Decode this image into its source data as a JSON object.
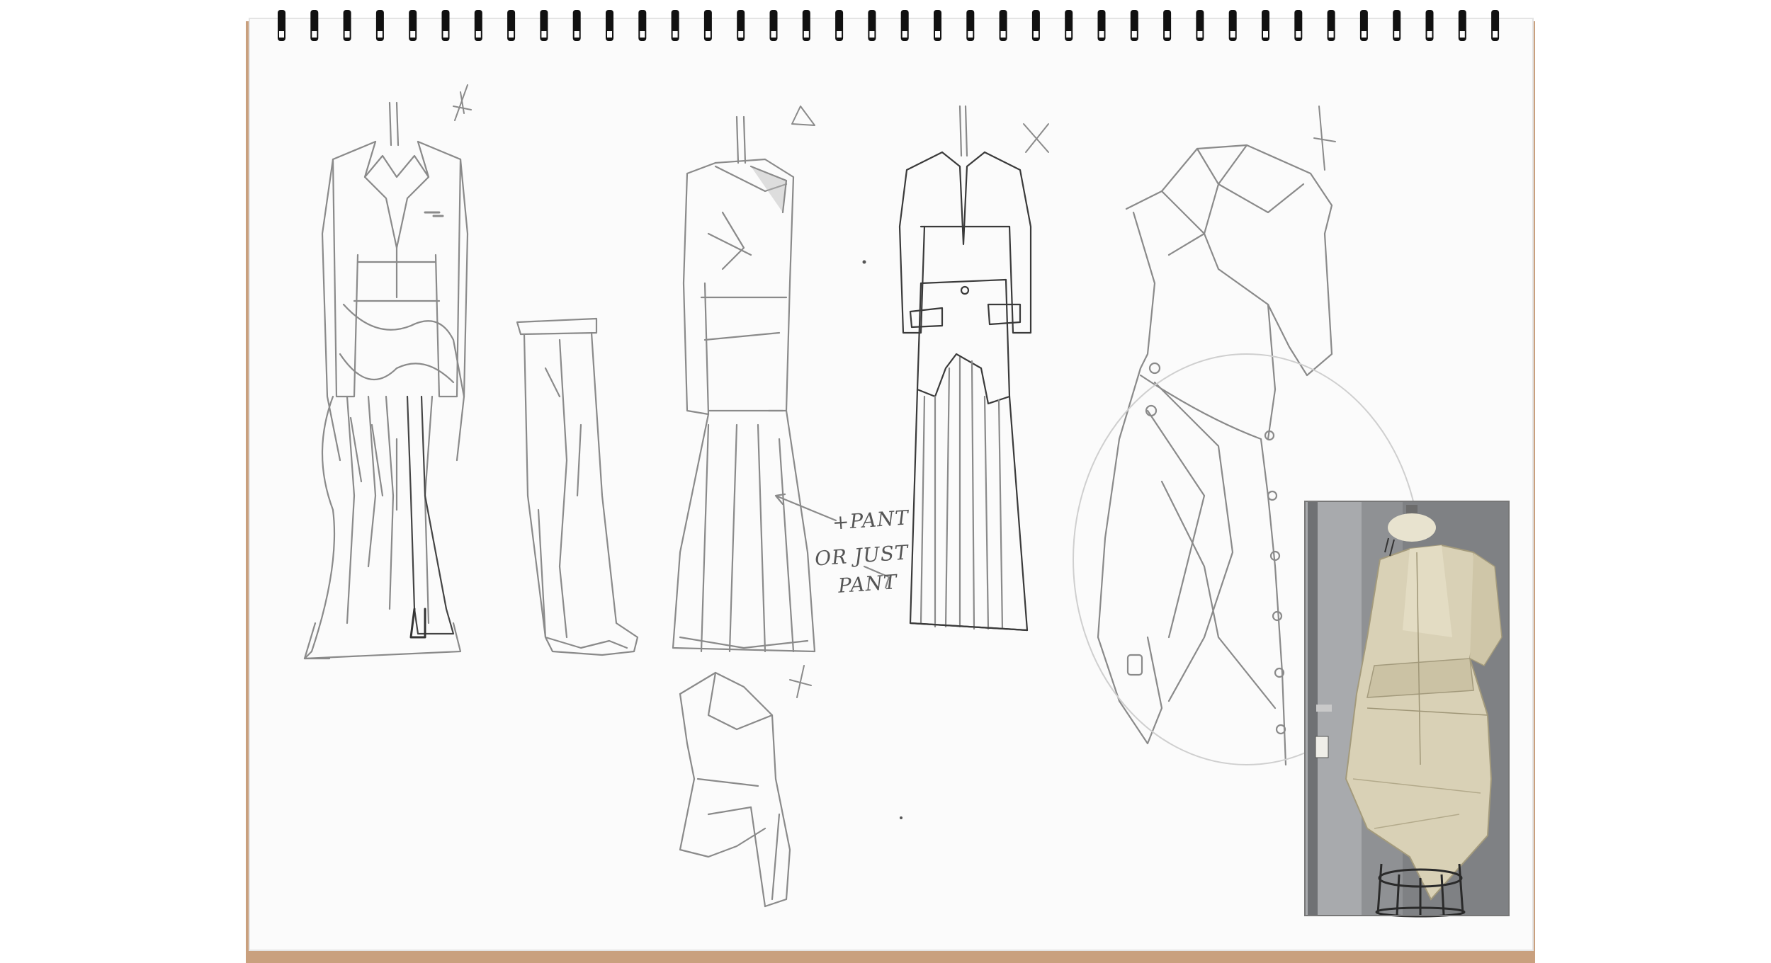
{
  "sketch_notes": {
    "line1": "+PANT",
    "line2": "OR JUST",
    "line3": "PANT"
  },
  "colors": {
    "paper": "#fbfbfb",
    "cardboard": "#c9a07e",
    "pencil": "#8a8a8a",
    "pencil_dark": "#2b2b2b",
    "spiral": "#111111",
    "muslin": "#d9d1b6",
    "photo_backdrop": "#8f9194"
  },
  "marks": [
    "star-mark",
    "triangle-mark",
    "x-mark",
    "star-mark",
    "star-mark"
  ],
  "images": [
    "sketch-suit-with-skirt",
    "sketch-wide-trousers",
    "sketch-asymmetric-top-with-pants",
    "sketch-blazer-over-pleated-skirt",
    "sketch-draped-wrap-dress",
    "sketch-draped-top",
    "photo-muslin-toile-on-dress-form"
  ]
}
